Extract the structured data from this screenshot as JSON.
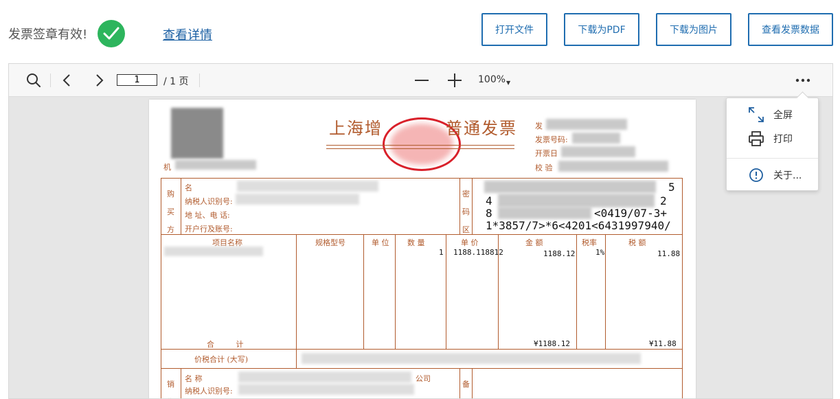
{
  "status": {
    "text": "发票签章有效!",
    "icon": "check-circle-icon",
    "icon_color": "#2db55d",
    "details_link": "查看详情"
  },
  "actions": {
    "open_file": "打开文件",
    "download_pdf": "下载为PDF",
    "download_image": "下载为图片",
    "view_invoice_data": "查看发票数据",
    "accent_color": "#1f6db0"
  },
  "viewer": {
    "toolbar": {
      "page_input": "1",
      "page_total": "/ 1 页",
      "zoom": "100%",
      "more_icon": "more-horizontal-icon"
    },
    "more_menu": {
      "items": [
        {
          "icon": "fullscreen-icon",
          "label": "全屏"
        },
        {
          "icon": "printer-icon",
          "label": "打印"
        },
        {
          "icon": "info-icon",
          "label": "关于..."
        }
      ]
    }
  },
  "invoice": {
    "title_left": "上海增",
    "title_right": "普通发票",
    "header_labels": {
      "code": "发",
      "number": "发票号码:",
      "date": "开票日",
      "check": "校  验",
      "machine": "机"
    },
    "buyer": {
      "side_label": "购买方",
      "name_label": "名",
      "tax_id_label": "纳税人识别号:",
      "address_label": "地 址、电 话:",
      "bank_label": "开户行及账号:"
    },
    "cipher_area": {
      "label": "密码区",
      "line1": "5",
      "line2": "4",
      "line2_end": "2",
      "line3_start": "8",
      "line3_end": "<0419/07-3+",
      "line4": "1*3857/7>*6<4201<6431997940/"
    },
    "items_header": [
      "项目名称",
      "规格型号",
      "单 位",
      "数 量",
      "单 价",
      "金 额",
      "税率",
      "税 额"
    ],
    "items": [
      {
        "name": "",
        "spec": "",
        "unit": "",
        "qty": "1",
        "price": "1188.118812",
        "amount": "1188.12",
        "rate": "1%",
        "tax": "11.88"
      }
    ],
    "totals": {
      "label": "合 计",
      "amount": "¥1188.12",
      "tax": "¥11.88"
    },
    "total_in_words_label": "价税合计 (大写)",
    "seller": {
      "side_label": "销售",
      "name_label": "名  称",
      "name_suffix": "公司",
      "tax_id_label": "纳税人识别号:",
      "remark_label": "备"
    },
    "colors": {
      "frame": "#b15b2d",
      "stamp": "#d9202a"
    }
  }
}
